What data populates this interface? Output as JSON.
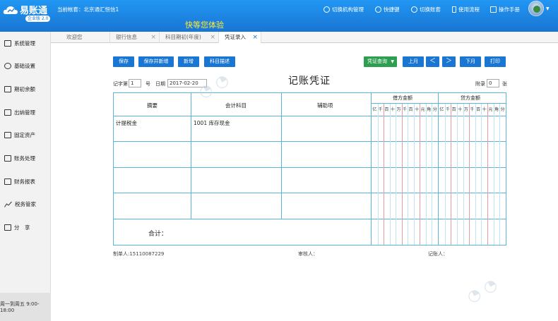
{
  "header": {
    "logo_title": "易账通",
    "logo_edition": "企业版 2.0",
    "account_label": "当前帐套：北京通汇恒信1",
    "slogan": "快等您体验",
    "actions": [
      "切换机构管理",
      "快捷键",
      "切换账套",
      "使用流程",
      "操作手册"
    ]
  },
  "sidebar": {
    "items": [
      "系统管理",
      "基础设置",
      "期初余额",
      "出纳管理",
      "固定资产",
      "账务处理",
      "财务报表",
      "税务管家",
      "分　享"
    ],
    "work_time": "周一到周五 9:00-18:00"
  },
  "tabs": [
    "欢迎您",
    "银行信息",
    "科目期初(年度)",
    "凭证录入"
  ],
  "toolbar": {
    "save": "保存",
    "save_new": "保存并新增",
    "add": "新增",
    "subject_desc": "科目描述",
    "query": "凭证查询",
    "prev_month": "上月",
    "prev": "＜",
    "next": "＞",
    "next_month": "下月",
    "print": "打印"
  },
  "voucher": {
    "word_label": "记字第",
    "word_no": "1",
    "no_label": "号",
    "date_label": "日期",
    "date": "2017-02-20",
    "title": "记账凭证",
    "attach_label": "附录",
    "attach_count": "0",
    "attach_unit": "张",
    "columns": {
      "summary": "摘要",
      "subject": "会计科目",
      "aux": "辅助项",
      "debit": "借方金额",
      "credit": "贷方金额"
    },
    "digit_units": [
      "亿",
      "千",
      "百",
      "十",
      "万",
      "千",
      "百",
      "十",
      "元",
      "角",
      "分"
    ],
    "rows": [
      {
        "summary": "计提税金",
        "subject": "1001 库存现金",
        "aux": ""
      },
      {
        "summary": "",
        "subject": "",
        "aux": ""
      },
      {
        "summary": "",
        "subject": "",
        "aux": ""
      },
      {
        "summary": "",
        "subject": "",
        "aux": ""
      }
    ],
    "total_label": "合计：",
    "maker": "制单人:15110087229",
    "auditor": "审核人：",
    "bookkeeper": "记账人："
  }
}
